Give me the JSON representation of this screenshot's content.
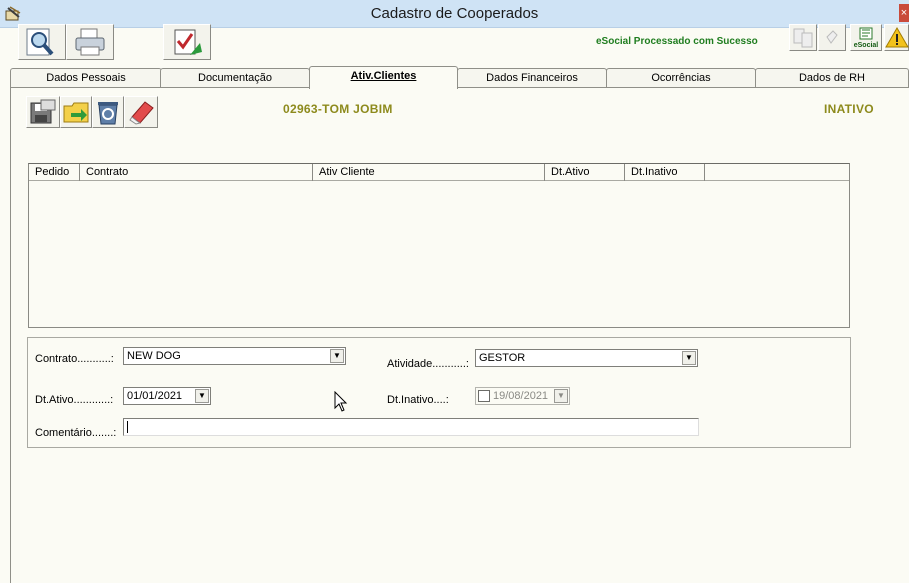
{
  "window": {
    "title": "Cadastro de Cooperados",
    "close_label": "×"
  },
  "toolbar": {
    "esocial_status": "eSocial Processado com Sucesso",
    "esocial_icon_label": "eSocial"
  },
  "tabs": [
    {
      "label": "Dados Pessoais",
      "active": false
    },
    {
      "label": "Documentação",
      "active": false
    },
    {
      "label": "Ativ.Clientes",
      "active": true
    },
    {
      "label": "Dados Financeiros",
      "active": false
    },
    {
      "label": "Ocorrências",
      "active": false
    },
    {
      "label": "Dados de RH",
      "active": false
    }
  ],
  "member": {
    "code_name": "02963-TOM JOBIM",
    "status": "INATIVO"
  },
  "grid": {
    "columns": [
      "Pedido",
      "Contrato",
      "Ativ Cliente",
      "Dt.Ativo",
      "Dt.Inativo"
    ],
    "rows": []
  },
  "form": {
    "contrato_label": "Contrato...........:",
    "contrato_value": "NEW DOG",
    "atividade_label": "Atividade...........:",
    "atividade_value": "GESTOR",
    "dt_ativo_label": "Dt.Ativo............:",
    "dt_ativo_value": "01/01/2021",
    "dt_inativo_label": "Dt.Inativo....:",
    "dt_inativo_value": "19/08/2021",
    "dt_inativo_checked": false,
    "comentario_label": "Comentário.......:",
    "comentario_value": ""
  },
  "colors": {
    "background": "#fbfbf4",
    "titlebar": "#cfe3f5",
    "member_text": "#8d8a1c",
    "esocial_text": "#1f7d1f"
  }
}
